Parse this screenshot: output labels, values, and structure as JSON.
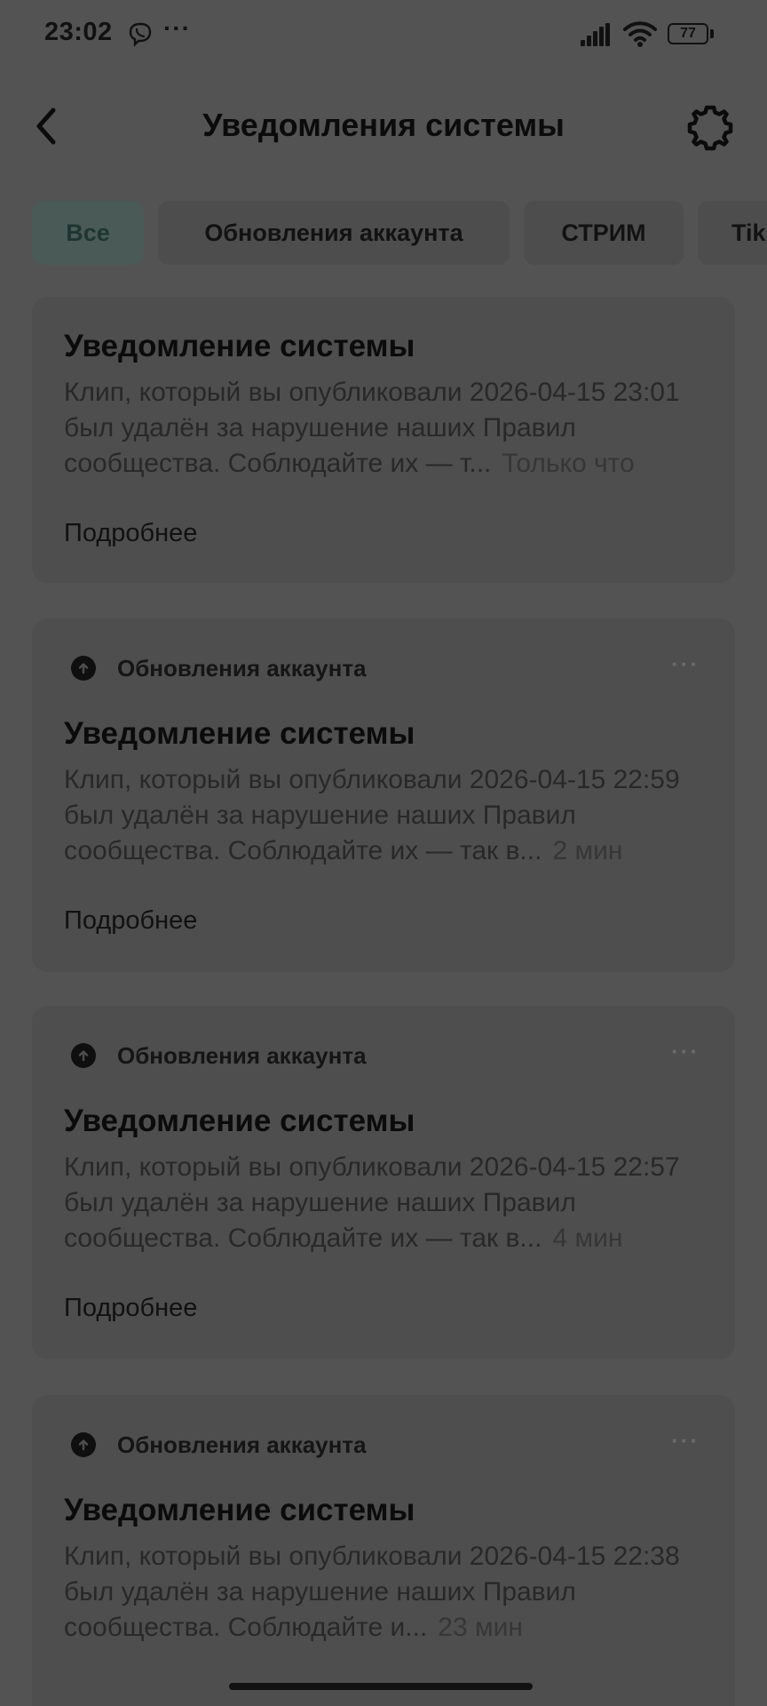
{
  "status_bar": {
    "time": "23:02",
    "more": "···",
    "battery": "77",
    "icons": [
      "viber-icon",
      "signal-icon",
      "wifi-icon",
      "battery-icon"
    ]
  },
  "header": {
    "title": "Уведомления системы",
    "back_icon": "chevron-left-icon",
    "settings_icon": "gear-icon"
  },
  "tabs": [
    {
      "label": "Все",
      "active": true
    },
    {
      "label": "Обновления аккаунта",
      "active": false
    },
    {
      "label": "СТРИМ",
      "active": false
    },
    {
      "label": "Tik",
      "active": false
    }
  ],
  "notifications": [
    {
      "category": "",
      "title": "Уведомление системы",
      "body": "Клип, который вы опубликовали 2026-04-15 23:01 был удалён за нарушение наших Правил сообщества. Соблюдайте их — т...",
      "time": "Только что",
      "link": "Подробнее"
    },
    {
      "category": "Обновления аккаунта",
      "title": "Уведомление системы",
      "body": "Клип, который вы опубликовали 2026-04-15 22:59 был удалён за нарушение наших Правил сообщества. Соблюдайте их — так в...",
      "time": "2 мин",
      "link": "Подробнее"
    },
    {
      "category": "Обновления аккаунта",
      "title": "Уведомление системы",
      "body": "Клип, который вы опубликовали 2026-04-15 22:57 был удалён за нарушение наших Правил сообщества. Соблюдайте их — так в...",
      "time": "4 мин",
      "link": "Подробнее"
    },
    {
      "category": "Обновления аккаунта",
      "title": "Уведомление системы",
      "body": "Клип, который вы опубликовали 2026-04-15 22:38 был удалён за нарушение наших Правил сообщества. Соблюдайте и...",
      "time": "23 мин",
      "link": ""
    }
  ],
  "card_more": "···",
  "colors": {
    "background": "#535353",
    "card": "#4e4e4e",
    "active_tab": "#4a5a56"
  }
}
